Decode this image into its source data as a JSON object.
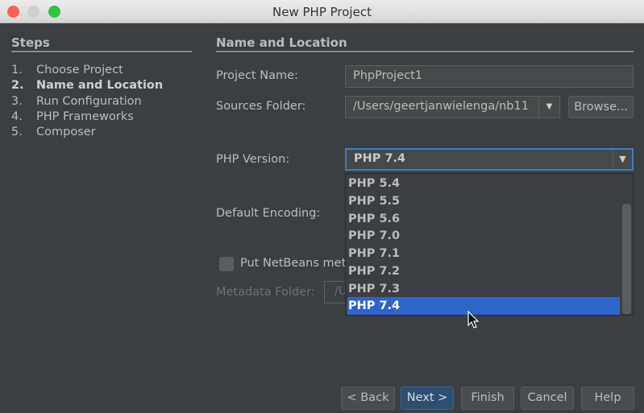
{
  "window": {
    "title": "New PHP Project"
  },
  "steps": {
    "header": "Steps",
    "items": [
      {
        "num": "1.",
        "label": "Choose Project"
      },
      {
        "num": "2.",
        "label": "Name and Location"
      },
      {
        "num": "3.",
        "label": "Run Configuration"
      },
      {
        "num": "4.",
        "label": "PHP Frameworks"
      },
      {
        "num": "5.",
        "label": "Composer"
      }
    ]
  },
  "panel": {
    "header": "Name and Location",
    "project_name_label": "Project Name:",
    "project_name_value": "PhpProject1",
    "sources_folder_label": "Sources Folder:",
    "sources_folder_value": "/Users/geertjanwielenga/nb11",
    "browse_label": "Browse...",
    "php_version_label": "PHP Version:",
    "php_version_value": "PHP 7.4",
    "php_version_options": [
      "PHP 5.4",
      "PHP 5.5",
      "PHP 5.6",
      "PHP 7.0",
      "PHP 7.1",
      "PHP 7.2",
      "PHP 7.3",
      "PHP 7.4"
    ],
    "default_encoding_label": "Default Encoding:",
    "put_netbeans_label": "Put NetBeans met",
    "metadata_folder_label": "Metadata Folder:",
    "metadata_folder_value": "/U"
  },
  "buttons": {
    "back": "< Back",
    "next": "Next >",
    "finish": "Finish",
    "cancel": "Cancel",
    "help": "Help"
  }
}
